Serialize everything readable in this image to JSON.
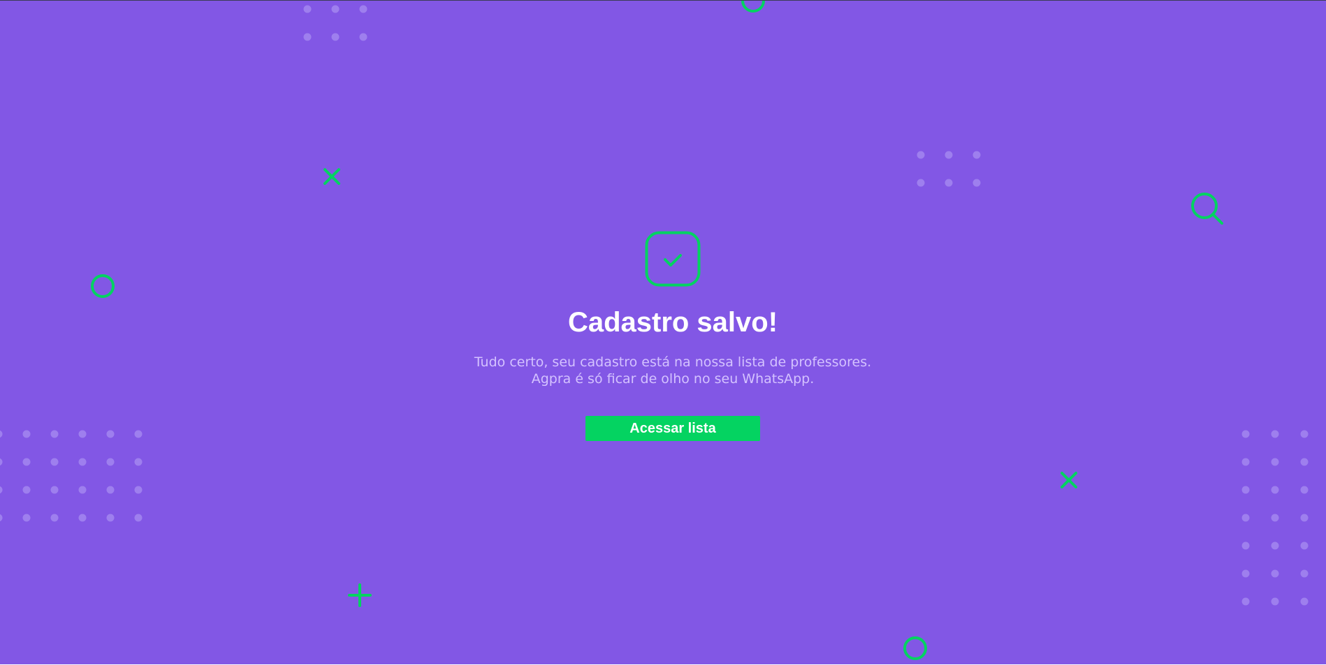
{
  "success": {
    "icon": "check-square-icon",
    "title": "Cadastro salvo!",
    "message_line_1": "Tudo certo, seu cadastro está na nossa lista de professores.",
    "message_line_2": "Agpra é só ficar de olho no seu WhatsApp.",
    "button_label": "Acessar lista"
  },
  "colors": {
    "background": "#8257e5",
    "accent": "#04d361",
    "text": "#ffffff",
    "text_muted": "#d4c2ff",
    "dots": "#9e7fee"
  },
  "decorations": {
    "icons": [
      "circle-icon",
      "x-icon",
      "plus-icon",
      "search-icon",
      "dot-grid-icon"
    ]
  }
}
